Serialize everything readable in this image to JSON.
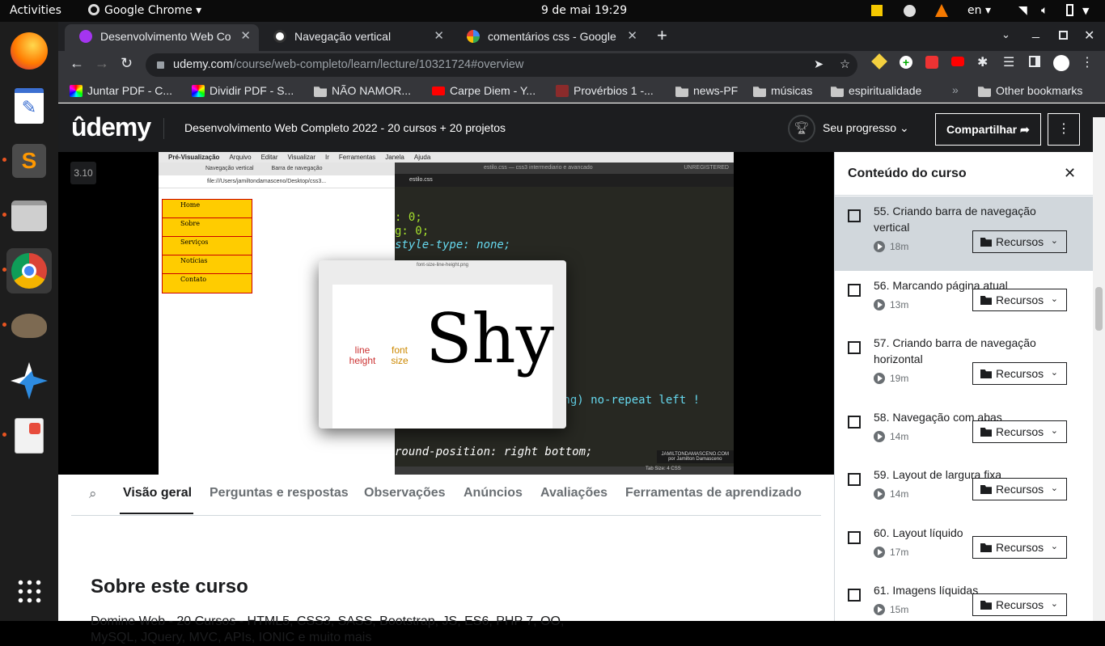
{
  "system": {
    "activities": "Activities",
    "app_menu": "Google Chrome",
    "clock": "9 de mai  19:29",
    "lang": "en"
  },
  "tabs": [
    {
      "label": "Desenvolvimento Web Co",
      "active": true
    },
    {
      "label": "Navegação vertical",
      "active": false
    },
    {
      "label": "comentários css - Google",
      "active": false
    }
  ],
  "address": {
    "domain": "udemy.com",
    "path": "/course/web-completo/learn/lecture/10321724#overview"
  },
  "bookmarks": [
    "Juntar PDF - C...",
    "Dividir PDF - S...",
    "NÃO NAMOR...",
    "Carpe Diem - Y...",
    "Provérbios 1 -...",
    "news-PF",
    "músicas",
    "espiritualidade",
    "Other bookmarks"
  ],
  "udemy": {
    "logo": "ûdemy",
    "course_title": "Desenvolvimento Web Completo 2022 - 20 cursos + 20 projetos",
    "progress": "Seu progresso",
    "share": "Compartilhar"
  },
  "video": {
    "badge": "3.10",
    "mac_menu": [
      "Pré-Visualização",
      "Arquivo",
      "Editar",
      "Visualizar",
      "Ir",
      "Ferramentas",
      "Janela",
      "Ajuda"
    ],
    "nav_items": [
      "Home",
      "Sobre",
      "Serviços",
      "Notícias",
      "Contato"
    ],
    "browser_tabs": [
      "Navegação vertical",
      "Barra de navegação"
    ],
    "file_url": "file:///Users/jamiltondamasceno/Desktop/css3...",
    "editor_tab": "estilo.css",
    "editor_title": "estilo.css — css3 intermediario e avancado",
    "unregistered": "UNREGISTERED",
    "preview_title": "font-size-line-height.png",
    "shy": "Shy",
    "line_height": "line height",
    "font_size": "font size",
    "code": [
      ": 0;",
      "g: 0;",
      "style-type: none;",
      "png) no-repeat left !",
      "round-position: right bottom;"
    ],
    "watermark": "JAMILTONDAMASCENO.COM",
    "watermark2": "por Jamilton Damasceno",
    "status": "Tab Size: 4",
    "status2": "CSS"
  },
  "nav_tabs": [
    "Visão geral",
    "Perguntas e respostas",
    "Observações",
    "Anúncios",
    "Avaliações",
    "Ferramentas de aprendizado"
  ],
  "about": {
    "heading": "Sobre este curso",
    "text": "Domine Web - 20 Cursos - HTML5, CSS3, SASS, Bootstrap, JS, ES6, PHP 7, OO,",
    "text2": "MySQL, JQuery, MVC, APIs, IONIC e muito mais"
  },
  "sidebar": {
    "title": "Conteúdo do curso",
    "resources_label": "Recursos",
    "lectures": [
      {
        "title": "55. Criando barra de navegação vertical",
        "duration": "18m",
        "current": true
      },
      {
        "title": "56. Marcando página atual",
        "duration": "13m"
      },
      {
        "title": "57. Criando barra de navegação horizontal",
        "duration": "19m"
      },
      {
        "title": "58. Navegação com abas",
        "duration": "14m"
      },
      {
        "title": "59. Layout de largura fixa",
        "duration": "14m"
      },
      {
        "title": "60. Layout líquido",
        "duration": "17m"
      },
      {
        "title": "61. Imagens líquidas",
        "duration": "15m"
      }
    ]
  }
}
